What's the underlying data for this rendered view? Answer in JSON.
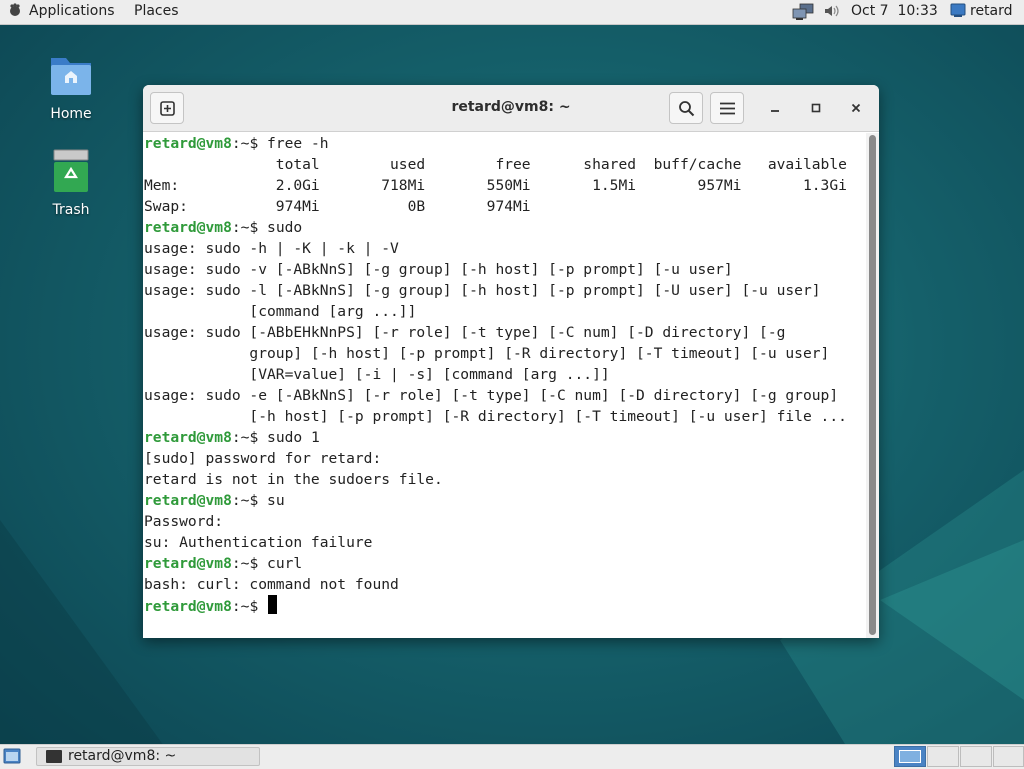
{
  "top_bar": {
    "applications_label": "Applications",
    "places_label": "Places",
    "clock": "Oct 7  10:33",
    "user": "retard",
    "icons": [
      "applications-icon",
      "network-icon",
      "volume-icon",
      "user-icon"
    ]
  },
  "desktop": {
    "icons": [
      {
        "label": "Home",
        "icon": "folder-home-icon"
      },
      {
        "label": "Trash",
        "icon": "trash-icon"
      }
    ]
  },
  "window": {
    "title": "retard@vm8: ~",
    "buttons": [
      "new-tab-icon",
      "search-icon",
      "menu-icon",
      "minimize-icon",
      "maximize-icon",
      "close-icon"
    ]
  },
  "terminal": {
    "prompt_user": "retard@vm8",
    "prompt_sep": ":~$ ",
    "lines": [
      {
        "prompt": true,
        "text": "free -h"
      },
      {
        "prompt": false,
        "text": "               total        used        free      shared  buff/cache   available"
      },
      {
        "prompt": false,
        "text": "Mem:           2.0Gi       718Mi       550Mi       1.5Mi       957Mi       1.3Gi"
      },
      {
        "prompt": false,
        "text": "Swap:          974Mi          0B       974Mi"
      },
      {
        "prompt": true,
        "text": "sudo"
      },
      {
        "prompt": false,
        "text": "usage: sudo -h | -K | -k | -V"
      },
      {
        "prompt": false,
        "text": "usage: sudo -v [-ABkNnS] [-g group] [-h host] [-p prompt] [-u user]"
      },
      {
        "prompt": false,
        "text": "usage: sudo -l [-ABkNnS] [-g group] [-h host] [-p prompt] [-U user] [-u user]"
      },
      {
        "prompt": false,
        "text": "            [command [arg ...]]"
      },
      {
        "prompt": false,
        "text": "usage: sudo [-ABbEHkNnPS] [-r role] [-t type] [-C num] [-D directory] [-g"
      },
      {
        "prompt": false,
        "text": "            group] [-h host] [-p prompt] [-R directory] [-T timeout] [-u user]"
      },
      {
        "prompt": false,
        "text": "            [VAR=value] [-i | -s] [command [arg ...]]"
      },
      {
        "prompt": false,
        "text": "usage: sudo -e [-ABkNnS] [-r role] [-t type] [-C num] [-D directory] [-g group]"
      },
      {
        "prompt": false,
        "text": "            [-h host] [-p prompt] [-R directory] [-T timeout] [-u user] file ..."
      },
      {
        "prompt": true,
        "text": "sudo 1"
      },
      {
        "prompt": false,
        "text": "[sudo] password for retard:"
      },
      {
        "prompt": false,
        "text": "retard is not in the sudoers file."
      },
      {
        "prompt": true,
        "text": "su"
      },
      {
        "prompt": false,
        "text": "Password:"
      },
      {
        "prompt": false,
        "text": "su: Authentication failure"
      },
      {
        "prompt": true,
        "text": "curl"
      },
      {
        "prompt": false,
        "text": "bash: curl: command not found"
      },
      {
        "prompt": true,
        "text": "",
        "cursor": true
      }
    ]
  },
  "taskbar": {
    "task_label": "retard@vm8: ~",
    "workspaces": 4,
    "active_workspace": 1
  },
  "colors": {
    "prompt_user": "#2f9a3a",
    "desktop_bg": "#15606a",
    "bar_bg": "#ededed"
  }
}
